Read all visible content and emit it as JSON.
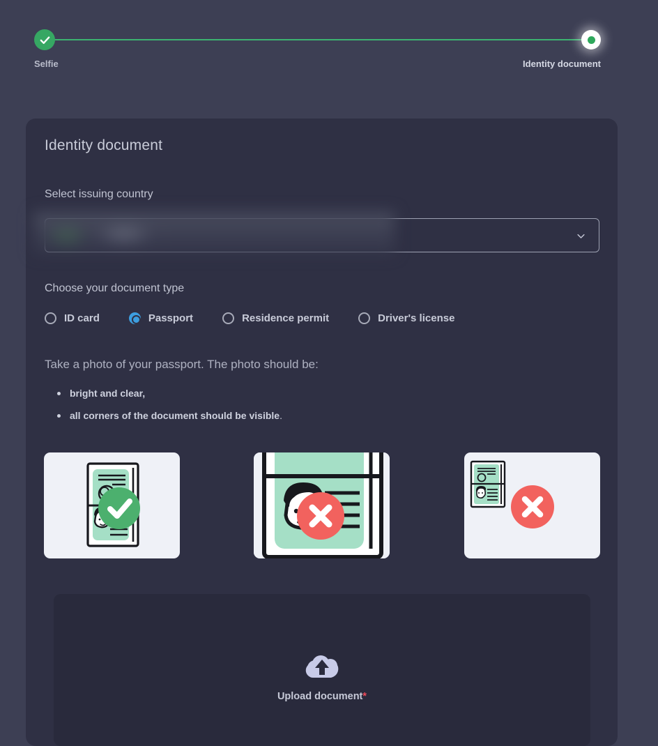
{
  "stepper": {
    "steps": [
      {
        "label": "Selfie",
        "state": "completed",
        "icon": "check-icon"
      },
      {
        "label": "Identity document",
        "state": "active",
        "icon": "dot-icon"
      }
    ],
    "track_color": "#3cb371",
    "completed_color": "#36a763",
    "active_color": "#2fa85c"
  },
  "card": {
    "title": "Identity document",
    "country": {
      "label": "Select issuing country",
      "value": "",
      "placeholder": "",
      "redacted": true,
      "chevron_icon": "chevron-down-icon"
    },
    "doc_type": {
      "label": "Choose your document type",
      "selected": "Passport",
      "accent_color": "#3d9ee0",
      "options": [
        {
          "label": "ID card",
          "selected": false
        },
        {
          "label": "Passport",
          "selected": true
        },
        {
          "label": "Residence permit",
          "selected": false
        },
        {
          "label": "Driver's license",
          "selected": false
        }
      ]
    },
    "instructions": {
      "intro": "Take a photo of your passport. The photo should be:",
      "bullets": [
        {
          "strong": "bright and clear,",
          "plain": ""
        },
        {
          "strong": "all corners of the document should be visible",
          "plain": "."
        }
      ]
    },
    "examples": [
      {
        "name": "good-example",
        "status": "ok",
        "badge_icon": "check-circle-icon",
        "badge_color": "#4cb06e",
        "card_color": "#eff1f7"
      },
      {
        "name": "too-close-example",
        "status": "bad",
        "badge_icon": "x-circle-icon",
        "badge_color": "#f2625e",
        "card_color": "#eff1f7"
      },
      {
        "name": "too-far-example",
        "status": "bad",
        "badge_icon": "x-circle-icon",
        "badge_color": "#f2625e",
        "card_color": "#eff1f7"
      }
    ],
    "upload": {
      "icon": "cloud-upload-icon",
      "label": "Upload document",
      "required_marker": "*",
      "required_color": "#f04b5a"
    }
  },
  "colors": {
    "page_background": "#3d3f54",
    "card_background": "#2f3044",
    "dropzone_background": "#292a3c",
    "text_primary": "#c8cbd8",
    "text_secondary": "#aeb1c1"
  }
}
